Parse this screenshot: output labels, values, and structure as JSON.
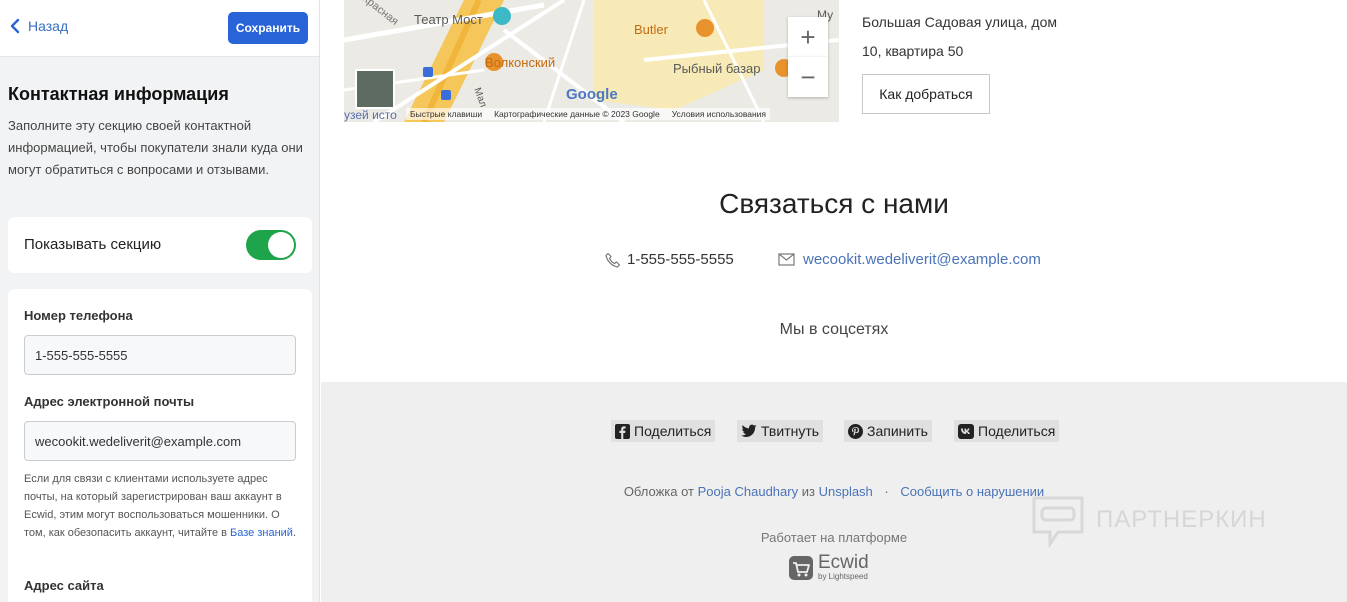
{
  "editor": {
    "back_label": "Назад",
    "save_label": "Сохранить",
    "section_title": "Контактная информация",
    "section_desc": "Заполните эту секцию своей контактной информацией, чтобы покупатели знали куда они могут обратиться с вопросами и отзывами.",
    "toggle_label": "Показывать секцию",
    "toggle_on": true,
    "phone_label": "Номер телефона",
    "phone_value": "1-555-555-5555",
    "email_label": "Адрес электронной почты",
    "email_value": "wecookit.wedeliverit@example.com",
    "hint_text": "Если для связи с клиентами используете адрес почты, на который зарегистрирован ваш аккаунт в Ecwid, этим могут воспользоваться мошенники. О том, как обезопасить аккаунт, читайте в ",
    "hint_link": "Базе знаний",
    "hint_end": ".",
    "site_label": "Адрес сайта"
  },
  "map": {
    "labels": {
      "teatr": "Театр Мост",
      "volkonsky": "Волконский",
      "butler": "Butler",
      "rybny": "Рыбный базар",
      "krasnaya": "Красная",
      "malaya": "Мал",
      "muzei": "узей исто",
      "mu": "Му",
      "google": "Google"
    },
    "footer": {
      "shortcuts": "Быстрые клавиши",
      "data": "Картографические данные © 2023 Google",
      "terms": "Условия использования"
    },
    "zoom_in": "+",
    "zoom_out": "−"
  },
  "address": {
    "line1": "Большая Садовая улица, дом",
    "line2": "10, квартира 50",
    "route_label": "Как добраться"
  },
  "contact": {
    "title": "Связаться с нами",
    "phone": "1-555-555-5555",
    "email": "wecookit.wedeliverit@example.com",
    "social_heading": "Мы в соцсетях"
  },
  "footer": {
    "share_fb": "Поделиться",
    "share_tw": "Твитнуть",
    "share_pin": "Запинить",
    "share_vk": "Поделиться",
    "credits_prefix": "Обложка от",
    "credits_author": "Pooja Chaudhary",
    "credits_mid": "из",
    "credits_source": "Unsplash",
    "credits_sep": "·",
    "report": "Сообщить о нарушении",
    "powered": "Работает на платформе",
    "ecwid_name": "Ecwid",
    "ecwid_sub": "by Lightspeed",
    "watermark": "ПАРТНЕРКИН"
  },
  "colors": {
    "accent": "#2864d8",
    "toggle_on": "#1ea44a",
    "link": "#4a73b8"
  }
}
